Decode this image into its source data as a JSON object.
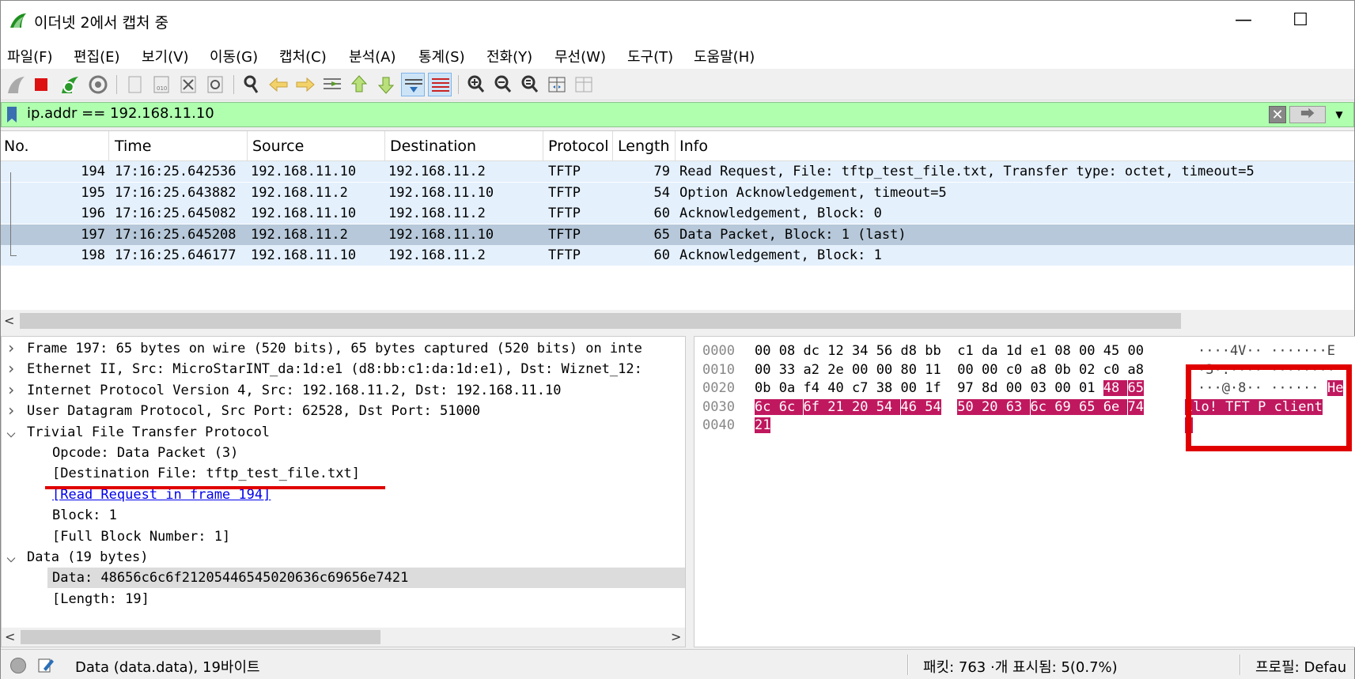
{
  "window": {
    "title": "이더넷 2에서 캡처 중",
    "minimize": "—",
    "maximize": "☐"
  },
  "menu": [
    "파일(F)",
    "편집(E)",
    "보기(V)",
    "이동(G)",
    "캡처(C)",
    "분석(A)",
    "통계(S)",
    "전화(Y)",
    "무선(W)",
    "도구(T)",
    "도움말(H)"
  ],
  "filter": {
    "value": "ip.addr == 192.168.11.10",
    "clear": "✕",
    "apply": "⮕",
    "dropdown": "▼"
  },
  "packet_list": {
    "columns": [
      "No.",
      "Time",
      "Source",
      "Destination",
      "Protocol",
      "Length",
      "Info"
    ],
    "rows": [
      {
        "no": "194",
        "time": "17:16:25.642536",
        "src": "192.168.11.10",
        "dst": "192.168.11.2",
        "proto": "TFTP",
        "len": "79",
        "info": "Read Request, File: tftp_test_file.txt, Transfer type: octet, timeout=5"
      },
      {
        "no": "195",
        "time": "17:16:25.643882",
        "src": "192.168.11.2",
        "dst": "192.168.11.10",
        "proto": "TFTP",
        "len": "54",
        "info": "Option Acknowledgement, timeout=5"
      },
      {
        "no": "196",
        "time": "17:16:25.645082",
        "src": "192.168.11.10",
        "dst": "192.168.11.2",
        "proto": "TFTP",
        "len": "60",
        "info": "Acknowledgement, Block: 0"
      },
      {
        "no": "197",
        "time": "17:16:25.645208",
        "src": "192.168.11.2",
        "dst": "192.168.11.10",
        "proto": "TFTP",
        "len": "65",
        "info": "Data Packet, Block: 1 (last)"
      },
      {
        "no": "198",
        "time": "17:16:25.646177",
        "src": "192.168.11.10",
        "dst": "192.168.11.2",
        "proto": "TFTP",
        "len": "60",
        "info": "Acknowledgement, Block: 1"
      }
    ],
    "selected_index": 3
  },
  "details": [
    {
      "arrow": ">",
      "indent": 0,
      "text": "Frame 197: 65 bytes on wire (520 bits), 65 bytes captured (520 bits) on inte"
    },
    {
      "arrow": ">",
      "indent": 0,
      "text": "Ethernet II, Src: MicroStarINT_da:1d:e1 (d8:bb:c1:da:1d:e1), Dst: Wiznet_12:"
    },
    {
      "arrow": ">",
      "indent": 0,
      "text": "Internet Protocol Version 4, Src: 192.168.11.2, Dst: 192.168.11.10"
    },
    {
      "arrow": ">",
      "indent": 0,
      "text": "User Datagram Protocol, Src Port: 62528, Dst Port: 51000"
    },
    {
      "arrow": "v",
      "indent": 0,
      "text": "Trivial File Transfer Protocol"
    },
    {
      "arrow": "",
      "indent": 1,
      "text": "Opcode: Data Packet (3)"
    },
    {
      "arrow": "",
      "indent": 1,
      "text": "[Destination File: tftp_test_file.txt]"
    },
    {
      "arrow": "",
      "indent": 1,
      "text": "[Read Request in frame 194]",
      "link": true
    },
    {
      "arrow": "",
      "indent": 1,
      "text": "Block: 1"
    },
    {
      "arrow": "",
      "indent": 1,
      "text": "[Full Block Number: 1]"
    },
    {
      "arrow": "v",
      "indent": 0,
      "text": "Data (19 bytes)"
    },
    {
      "arrow": "",
      "indent": 1,
      "text": "Data: 48656c6c6f21205446545020636c69656e7421",
      "highlight": true
    },
    {
      "arrow": "",
      "indent": 1,
      "text": "[Length: 19]"
    }
  ],
  "bytes": [
    {
      "offset": "0000",
      "hex": [
        "00",
        "08",
        "dc",
        "12",
        "34",
        "56",
        "d8",
        "bb",
        "c1",
        "da",
        "1d",
        "e1",
        "08",
        "00",
        "45",
        "00"
      ],
      "ascii": "····4V·· ·······E",
      "sel_from": 99,
      "ascii_sel": ""
    },
    {
      "offset": "0010",
      "hex": [
        "00",
        "33",
        "a2",
        "2e",
        "00",
        "00",
        "80",
        "11",
        "00",
        "00",
        "c0",
        "a8",
        "0b",
        "02",
        "c0",
        "a8"
      ],
      "ascii": "·3·.···· ········",
      "sel_from": 99,
      "ascii_sel": ""
    },
    {
      "offset": "0020",
      "hex": [
        "0b",
        "0a",
        "f4",
        "40",
        "c7",
        "38",
        "00",
        "1f",
        "97",
        "8d",
        "00",
        "03",
        "00",
        "01",
        "48",
        "65"
      ],
      "ascii": "···@·8·· ······",
      "sel_from": 14,
      "ascii_sel": "He"
    },
    {
      "offset": "0030",
      "hex": [
        "6c",
        "6c",
        "6f",
        "21",
        "20",
        "54",
        "46",
        "54",
        "50",
        "20",
        "63",
        "6c",
        "69",
        "65",
        "6e",
        "74"
      ],
      "ascii": "",
      "sel_from": 0,
      "ascii_sel": "llo! TFT P client"
    },
    {
      "offset": "0040",
      "hex": [
        "21"
      ],
      "ascii": "",
      "sel_from": 0,
      "ascii_sel": "!"
    }
  ],
  "status": {
    "field": "Data (data.data), 19바이트",
    "packets": "패킷: 763 ·개 표시됨: 5(0.7%)",
    "profile": "프로필: Defau"
  },
  "colors": {
    "filter_valid": "#afffaf",
    "row_bg": "#e4f0fc",
    "row_selected": "#b6c8d9",
    "byte_selected": "#c0185f",
    "annotation": "#e00000"
  }
}
